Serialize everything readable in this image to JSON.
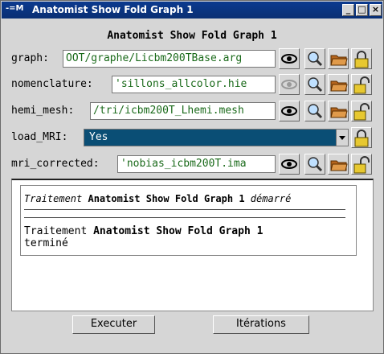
{
  "window": {
    "title": "Anatomist Show Fold Graph 1",
    "app_icon": "-=M",
    "controls": [
      "minimize-icon",
      "maximize-icon",
      "close-icon"
    ]
  },
  "heading": "Anatomist Show Fold Graph 1",
  "params": {
    "graph": {
      "label": "graph:",
      "value": "OOT/graphe/Licbm200TBase.arg"
    },
    "nomenclature": {
      "label": "nomenclature:",
      "value": "'sillons_allcolor.hie"
    },
    "hemi_mesh": {
      "label": "hemi_mesh:",
      "value": "/tri/icbm200T_Lhemi.mesh"
    },
    "load_MRI": {
      "label": "load_MRI:",
      "value": "Yes"
    },
    "mri_corrected": {
      "label": "mri_corrected:",
      "value": "'nobias_icbm200T.ima"
    }
  },
  "log": {
    "line1_italic_start": "Traitement",
    "line1_bold": "Anatomist Show Fold Graph 1",
    "line1_italic_end": "démarré",
    "line2_start": "Traitement",
    "line2_bold": "Anatomist Show Fold Graph 1",
    "line2_end": "terminé"
  },
  "buttons": {
    "execute": "Executer",
    "iterations": "Itérations"
  },
  "icons": {
    "eye": "eye-icon",
    "magnifier": "magnifier-icon",
    "folder": "folder-icon",
    "lock": "lock-icon",
    "unlock": "unlock-icon"
  },
  "colors": {
    "titlebar": "#0b3a8f",
    "field_text": "#1a6a1a",
    "combo_bg": "#0a4e75"
  }
}
